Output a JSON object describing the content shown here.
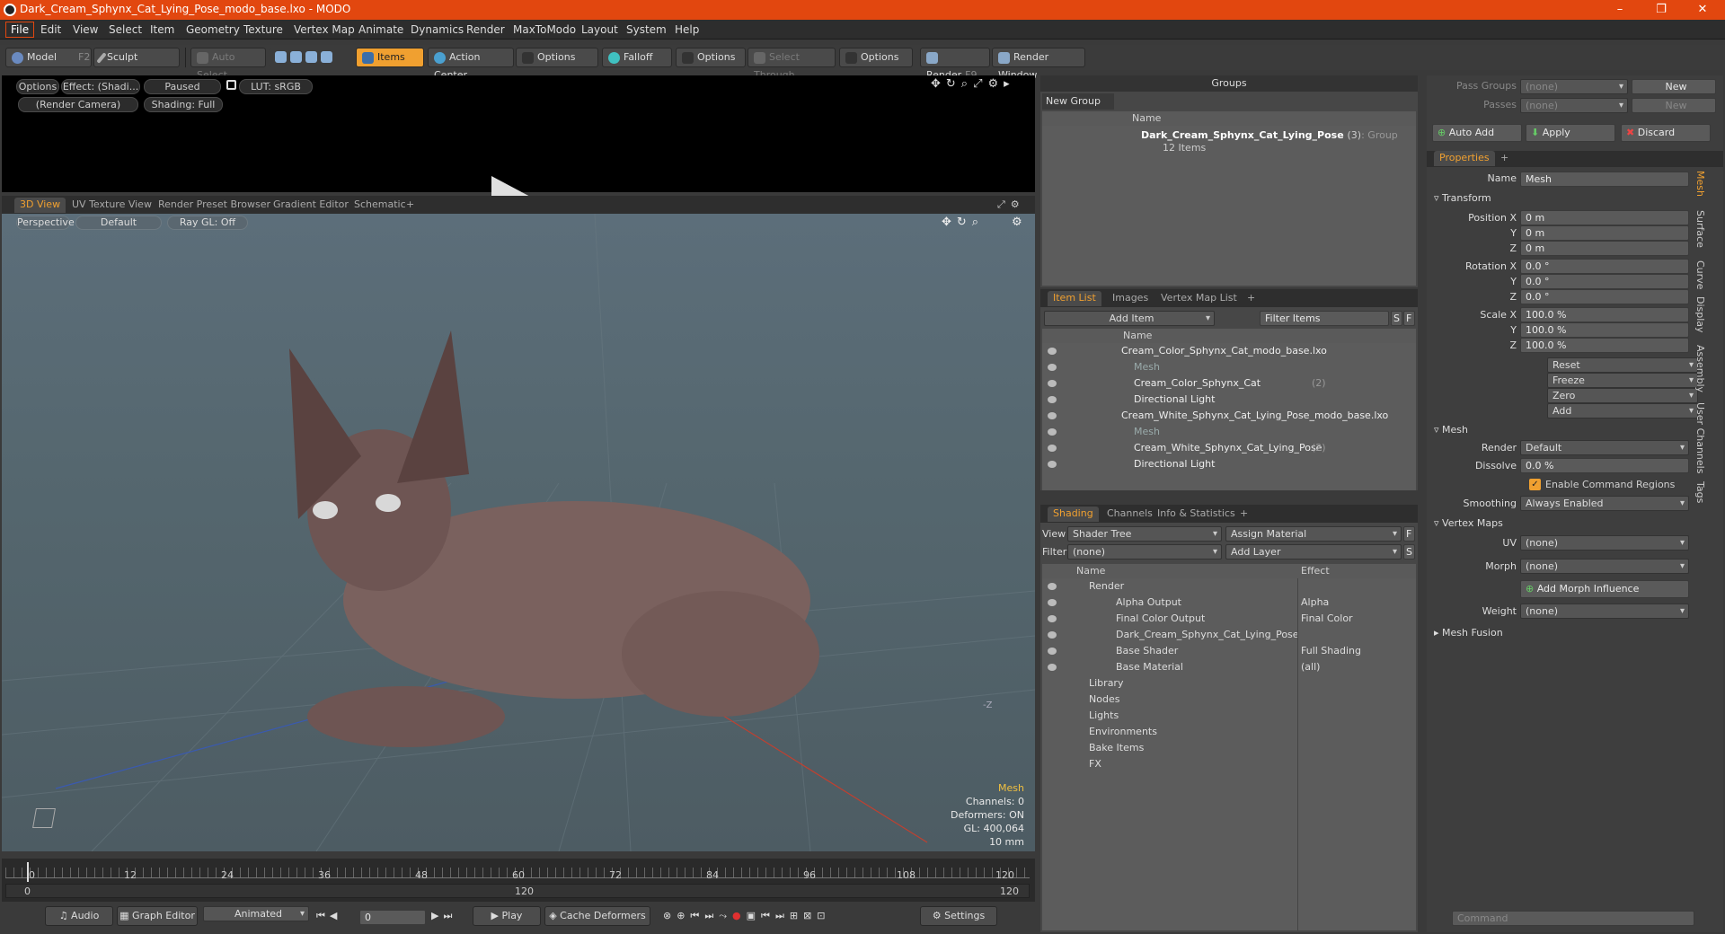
{
  "app": {
    "title": "Dark_Cream_Sphynx_Cat_Lying_Pose_modo_base.lxo - MODO"
  },
  "menu": [
    "File",
    "Edit",
    "View",
    "Select",
    "Item",
    "Geometry",
    "Texture",
    "Vertex Map",
    "Animate",
    "Dynamics",
    "Render",
    "MaxToModo",
    "Layout",
    "System",
    "Help"
  ],
  "toolbar": {
    "model": "Model",
    "model_key": "F2",
    "sculpt": "Sculpt",
    "auto_select": "Auto Select",
    "items": "Items",
    "action_center": "Action Center",
    "options1": "Options",
    "falloff": "Falloff",
    "options2": "Options",
    "select_through": "Select Through",
    "options3": "Options",
    "render": "Render",
    "render_key": "F9",
    "render_window": "Render Window"
  },
  "preview": {
    "options": "Options",
    "effect": "Effect: (Shadi...",
    "paused": "Paused",
    "lut": "LUT: sRGB",
    "camera": "(Render Camera)",
    "shading": "Shading: Full"
  },
  "viewtabs": [
    "3D View",
    "UV Texture View",
    "Render Preset Browser",
    "Gradient Editor",
    "Schematic",
    "+"
  ],
  "viewport": {
    "perspective": "Perspective",
    "default": "Default",
    "raygl": "Ray GL: Off",
    "info_title": "Mesh",
    "channels": "Channels: 0",
    "deformers": "Deformers: ON",
    "gl": "GL: 400,064",
    "scale": "10 mm",
    "z_label": "-Z"
  },
  "timeline": {
    "ticks": [
      "0",
      "12",
      "24",
      "36",
      "48",
      "60",
      "72",
      "84",
      "96",
      "108",
      "120"
    ],
    "sub": [
      "0",
      "120",
      "120"
    ]
  },
  "bottombar": {
    "audio": "Audio",
    "graph": "Graph Editor",
    "animated": "Animated",
    "frame": "0",
    "play": "Play",
    "cache": "Cache Deformers",
    "settings": "Settings"
  },
  "groups": {
    "header": "Groups",
    "new_group": "New Group",
    "col_name": "Name",
    "group_name": "Dark_Cream_Sphynx_Cat_Lying_Pose",
    "group_count": "(3)",
    "group_type": ": Group",
    "group_items": "12 Items"
  },
  "itemlist": {
    "tabs": [
      "Item List",
      "Images",
      "Vertex Map List",
      "+"
    ],
    "add_item": "Add Item",
    "filter": "Filter Items",
    "s": "S",
    "f": "F",
    "col_name": "Name",
    "rows": [
      {
        "label": "Cream_Color_Sphynx_Cat_modo_base.lxo",
        "indent": 0,
        "dim": false,
        "suffix": ""
      },
      {
        "label": "Mesh",
        "indent": 1,
        "dim": true,
        "suffix": ""
      },
      {
        "label": "Cream_Color_Sphynx_Cat",
        "indent": 1,
        "dim": false,
        "suffix": "(2)"
      },
      {
        "label": "Directional Light",
        "indent": 1,
        "dim": false,
        "suffix": ""
      },
      {
        "label": "Cream_White_Sphynx_Cat_Lying_Pose_modo_base.lxo",
        "indent": 0,
        "dim": false,
        "suffix": ""
      },
      {
        "label": "Mesh",
        "indent": 1,
        "dim": true,
        "suffix": ""
      },
      {
        "label": "Cream_White_Sphynx_Cat_Lying_Pose",
        "indent": 1,
        "dim": false,
        "suffix": "(2)"
      },
      {
        "label": "Directional Light",
        "indent": 1,
        "dim": false,
        "suffix": ""
      }
    ]
  },
  "shading": {
    "tabs": [
      "Shading",
      "Channels",
      "Info & Statistics",
      "+"
    ],
    "view_label": "View",
    "view_value": "Shader Tree",
    "assign": "Assign Material",
    "f": "F",
    "filter_label": "Filter",
    "filter_value": "(none)",
    "add_layer": "Add Layer",
    "s": "S",
    "col_name": "Name",
    "col_effect": "Effect",
    "rows": [
      {
        "label": "Render",
        "effect": "",
        "indent": 0
      },
      {
        "label": "Alpha Output",
        "effect": "Alpha",
        "indent": 1
      },
      {
        "label": "Final Color Output",
        "effect": "Final Color",
        "indent": 1
      },
      {
        "label": "Dark_Cream_Sphynx_Cat_Lying_Pose",
        "effect": "",
        "indent": 1
      },
      {
        "label": "Base Shader",
        "effect": "Full Shading",
        "indent": 1
      },
      {
        "label": "Base Material",
        "effect": "(all)",
        "indent": 1
      },
      {
        "label": "Library",
        "effect": "",
        "indent": 0
      },
      {
        "label": "Nodes",
        "effect": "",
        "indent": 0
      },
      {
        "label": "Lights",
        "effect": "",
        "indent": 0
      },
      {
        "label": "Environments",
        "effect": "",
        "indent": 0
      },
      {
        "label": "Bake Items",
        "effect": "",
        "indent": 0
      },
      {
        "label": "FX",
        "effect": "",
        "indent": 0
      }
    ]
  },
  "props": {
    "pass_groups": "Pass Groups",
    "pass_groups_val": "(none)",
    "new": "New",
    "passes": "Passes",
    "passes_val": "(none)",
    "new2": "New",
    "auto_add": "Auto Add",
    "apply": "Apply",
    "discard": "Discard",
    "tab": "Properties",
    "plus": "+",
    "name_label": "Name",
    "name_val": "Mesh",
    "transform": "Transform",
    "pos_x": "Position X",
    "y": "Y",
    "z": "Z",
    "pos_vals": [
      "0 m",
      "0 m",
      "0 m"
    ],
    "rot_x": "Rotation X",
    "rot_vals": [
      "0.0 °",
      "0.0 °",
      "0.0 °"
    ],
    "scale_x": "Scale X",
    "scale_vals": [
      "100.0 %",
      "100.0 %",
      "100.0 %"
    ],
    "reset": "Reset",
    "freeze": "Freeze",
    "zero": "Zero",
    "add": "Add",
    "mesh": "Mesh",
    "render_label": "Render",
    "render_val": "Default",
    "dissolve_label": "Dissolve",
    "dissolve_val": "0.0 %",
    "enable_cmd": "Enable Command Regions",
    "smoothing_label": "Smoothing",
    "smoothing_val": "Always Enabled",
    "vertex_maps": "Vertex Maps",
    "uv_label": "UV",
    "uv_val": "(none)",
    "morph_label": "Morph",
    "morph_val": "(none)",
    "add_morph": "Add Morph Influence",
    "weight_label": "Weight",
    "weight_val": "(none)",
    "mesh_fusion": "Mesh Fusion",
    "command": "Command",
    "side_tabs": [
      "Mesh",
      "Surface",
      "Curve",
      "Display",
      "Assembly",
      "User Channels",
      "Tags"
    ]
  },
  "colors": {
    "accent": "#f0a030",
    "title": "#e2470f"
  }
}
